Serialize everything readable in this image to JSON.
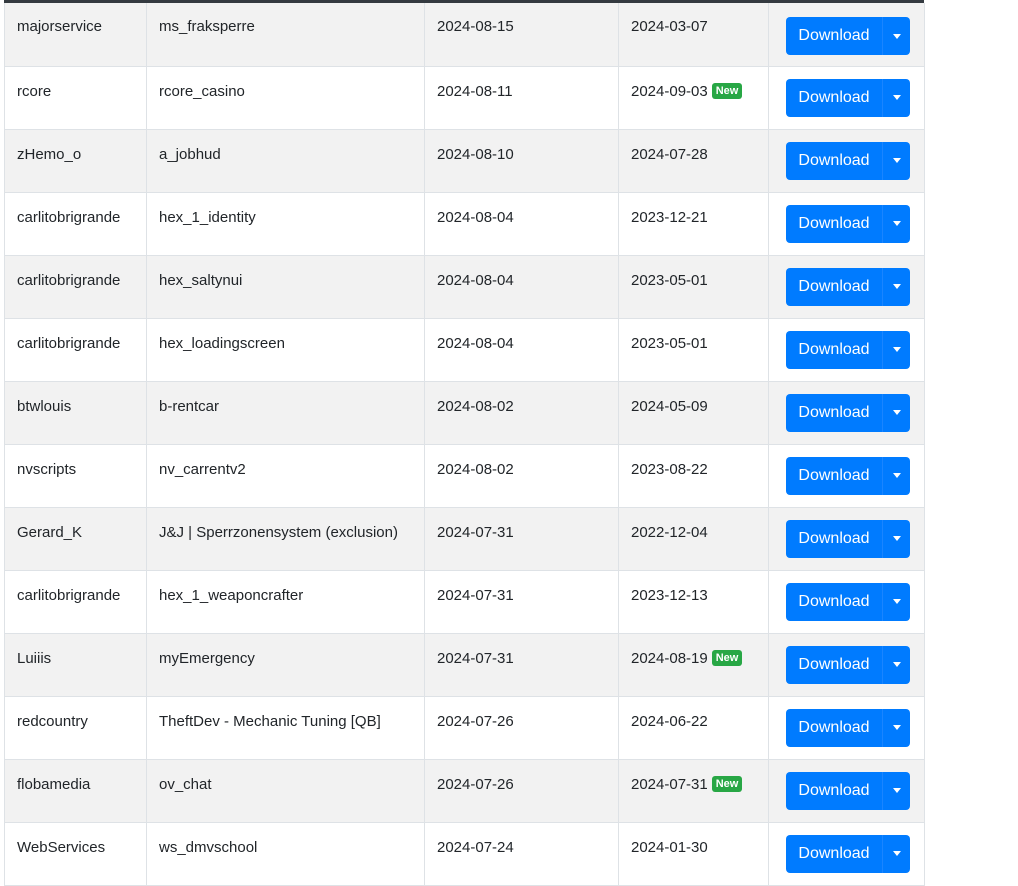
{
  "table": {
    "download_label": "Download",
    "new_badge": "New",
    "rows": [
      {
        "author": "majorservice",
        "resource": "ms_fraksperre",
        "date1": "2024-08-15",
        "date2": "2024-03-07",
        "is_new": false
      },
      {
        "author": "rcore",
        "resource": "rcore_casino",
        "date1": "2024-08-11",
        "date2": "2024-09-03",
        "is_new": true
      },
      {
        "author": "zHemo_o",
        "resource": "a_jobhud",
        "date1": "2024-08-10",
        "date2": "2024-07-28",
        "is_new": false
      },
      {
        "author": "carlitobrigrande",
        "resource": "hex_1_identity",
        "date1": "2024-08-04",
        "date2": "2023-12-21",
        "is_new": false
      },
      {
        "author": "carlitobrigrande",
        "resource": "hex_saltynui",
        "date1": "2024-08-04",
        "date2": "2023-05-01",
        "is_new": false
      },
      {
        "author": "carlitobrigrande",
        "resource": "hex_loadingscreen",
        "date1": "2024-08-04",
        "date2": "2023-05-01",
        "is_new": false
      },
      {
        "author": "btwlouis",
        "resource": "b-rentcar",
        "date1": "2024-08-02",
        "date2": "2024-05-09",
        "is_new": false
      },
      {
        "author": "nvscripts",
        "resource": "nv_carrentv2",
        "date1": "2024-08-02",
        "date2": "2023-08-22",
        "is_new": false
      },
      {
        "author": "Gerard_K",
        "resource": "J&J | Sperrzonensystem (exclusion)",
        "date1": "2024-07-31",
        "date2": "2022-12-04",
        "is_new": false
      },
      {
        "author": "carlitobrigrande",
        "resource": "hex_1_weaponcrafter",
        "date1": "2024-07-31",
        "date2": "2023-12-13",
        "is_new": false
      },
      {
        "author": "Luiiis",
        "resource": "myEmergency",
        "date1": "2024-07-31",
        "date2": "2024-08-19",
        "is_new": true
      },
      {
        "author": "redcountry",
        "resource": "TheftDev - Mechanic Tuning [QB]",
        "date1": "2024-07-26",
        "date2": "2024-06-22",
        "is_new": false
      },
      {
        "author": "flobamedia",
        "resource": "ov_chat",
        "date1": "2024-07-26",
        "date2": "2024-07-31",
        "is_new": true
      },
      {
        "author": "WebServices",
        "resource": "ws_dmvschool",
        "date1": "2024-07-24",
        "date2": "2024-01-30",
        "is_new": false
      }
    ]
  },
  "colors": {
    "primary": "#007bff",
    "badge_new": "#28a745",
    "row_stripe": "#f2f2f2",
    "border": "#dee2e6"
  },
  "icons": {
    "dropdown_toggle": "caret-down-icon"
  }
}
